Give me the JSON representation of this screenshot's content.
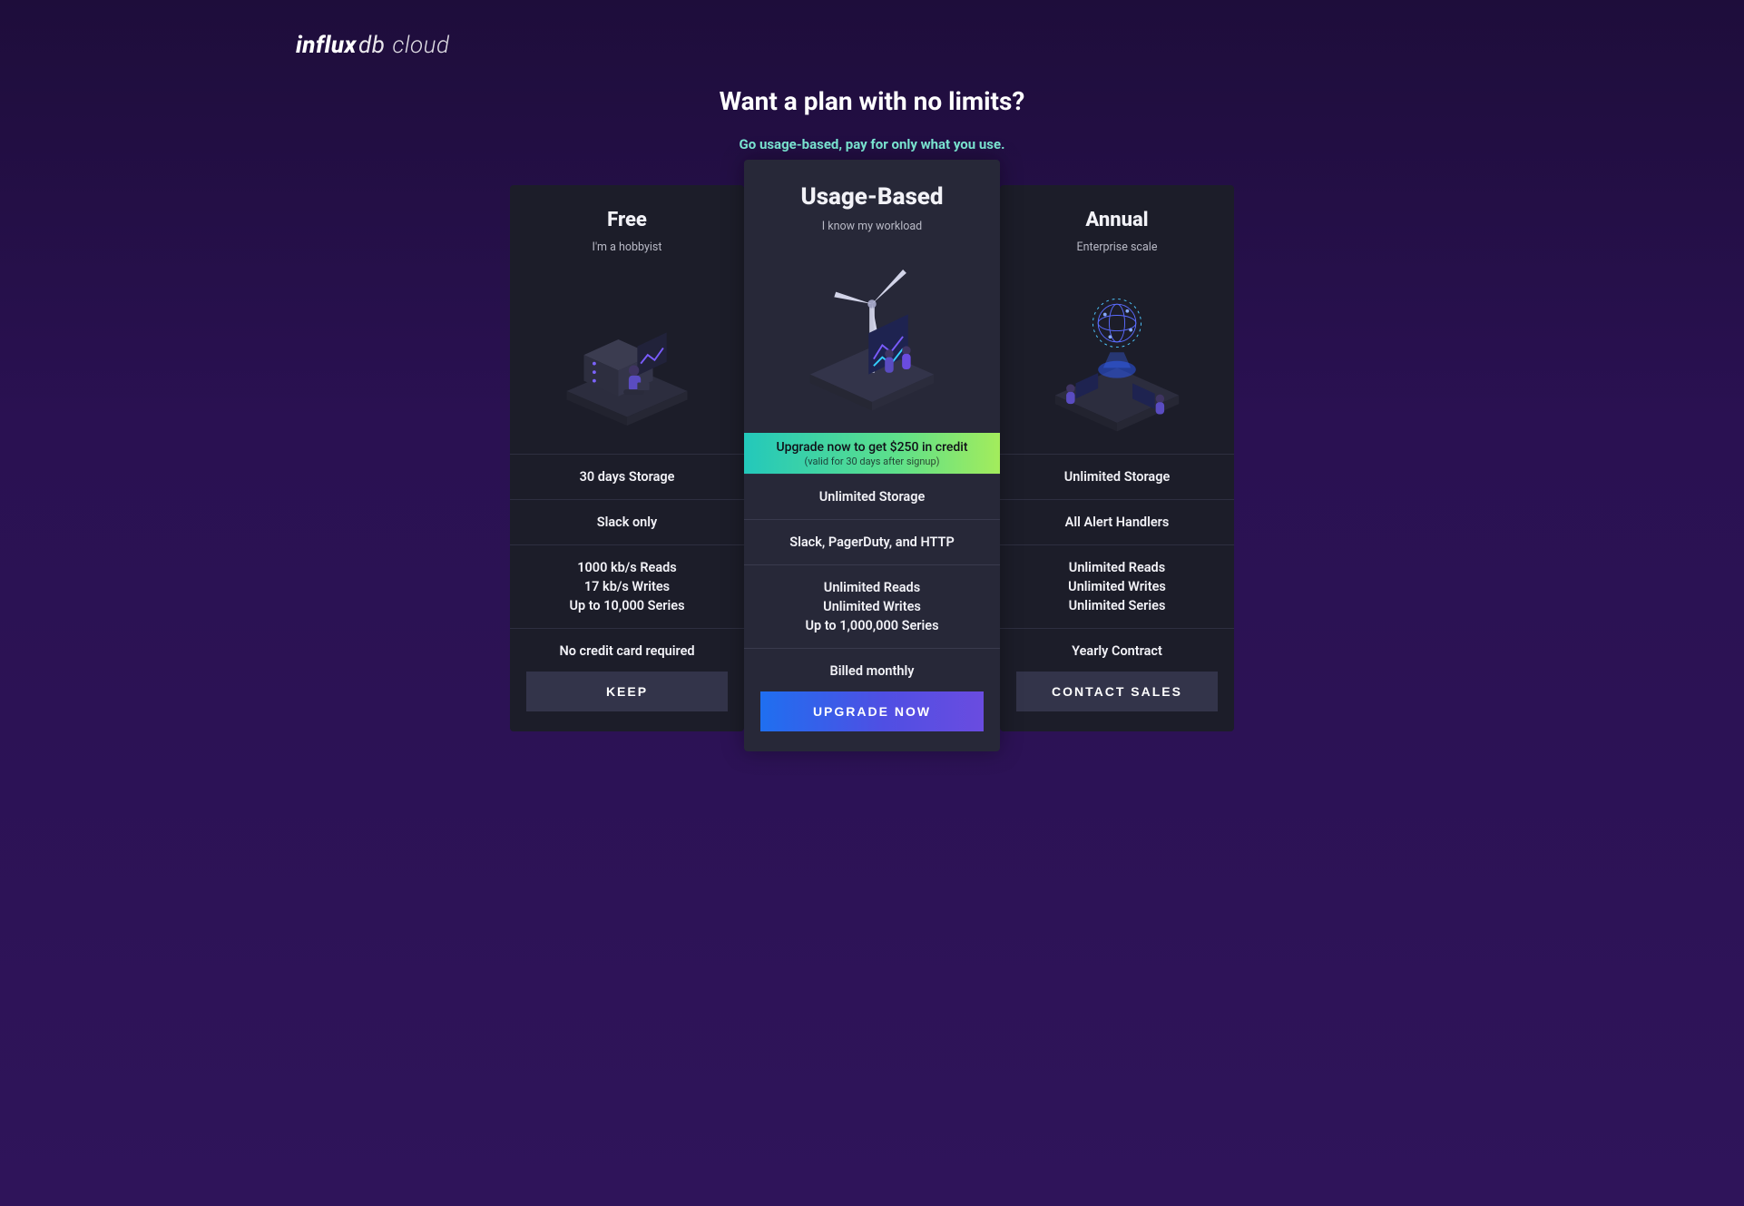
{
  "brand": {
    "bold": "influx",
    "light": "db",
    "cloud": "cloud"
  },
  "header": {
    "title": "Want a plan with no limits?",
    "subtitle": "Go usage-based, pay for only what you use."
  },
  "plans": {
    "free": {
      "title": "Free",
      "tagline": "I'm a hobbyist",
      "features": {
        "storage": "30 days Storage",
        "alerts": "Slack only",
        "reads": "1000 kb/s Reads",
        "writes": "17 kb/s Writes",
        "series": "Up to 10,000 Series"
      },
      "footer_note": "No credit card required",
      "button": "KEEP"
    },
    "usage": {
      "title": "Usage-Based",
      "tagline": "I know my workload",
      "promo": {
        "line1": "Upgrade now to get $250 in credit",
        "line2": "(valid for 30 days after signup)"
      },
      "features": {
        "storage": "Unlimited Storage",
        "alerts": "Slack, PagerDuty, and HTTP",
        "reads": "Unlimited Reads",
        "writes": "Unlimited Writes",
        "series": "Up to 1,000,000 Series"
      },
      "footer_note": "Billed monthly",
      "button": "UPGRADE NOW"
    },
    "annual": {
      "title": "Annual",
      "tagline": "Enterprise scale",
      "features": {
        "storage": "Unlimited Storage",
        "alerts": "All Alert Handlers",
        "reads": "Unlimited Reads",
        "writes": "Unlimited Writes",
        "series": "Unlimited Series"
      },
      "footer_note": "Yearly Contract",
      "button": "CONTACT SALES"
    }
  }
}
